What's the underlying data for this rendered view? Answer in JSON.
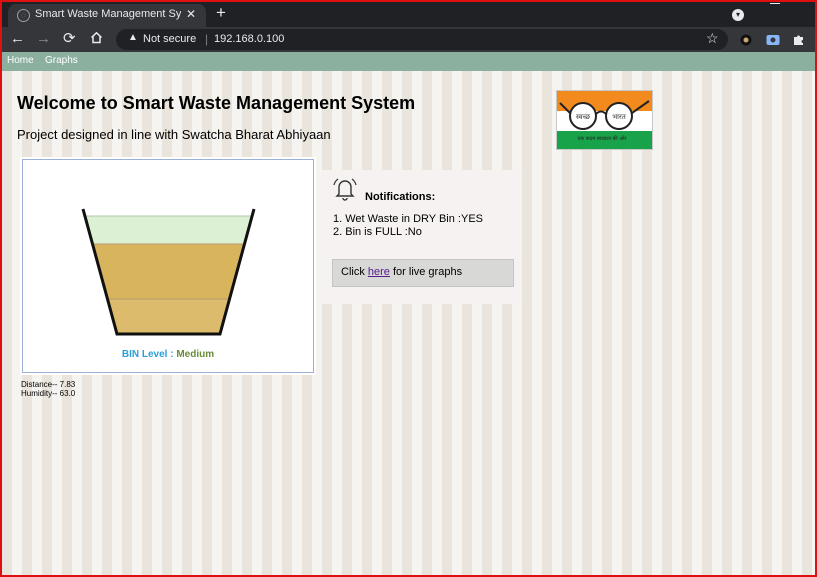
{
  "browser": {
    "tab_title": "Smart Waste Management Syste",
    "security_label": "Not secure",
    "url": "192.168.0.100"
  },
  "nav": {
    "items": [
      {
        "label": "Home"
      },
      {
        "label": "Graphs"
      }
    ]
  },
  "header": {
    "title": "Welcome to Smart Waste Management System",
    "subtitle": "Project designed in line with Swatcha Bharat Abhiyaan"
  },
  "logo": {
    "left_word": "स्वच्छ",
    "right_word": "भारत",
    "tagline": "एक कदम स्वच्छता की ओर"
  },
  "bin": {
    "level_label": "BIN Level : ",
    "level_value": "Medium",
    "fill_layers": [
      "light",
      "medium",
      "medium"
    ]
  },
  "readings": {
    "distance": "Distance-- 7.83",
    "humidity": "Humidity-- 63.0"
  },
  "notifications": {
    "title": "Notifications:",
    "items": [
      "1. Wet Waste in DRY Bin :YES",
      "2. Bin is FULL :No"
    ],
    "link_prefix": "Click ",
    "link_text": "here",
    "link_suffix": " for live graphs"
  },
  "colors": {
    "navbar": "#8bb0a0",
    "level_label": "#2a9fd6",
    "level_value": "#6a8a3a"
  }
}
